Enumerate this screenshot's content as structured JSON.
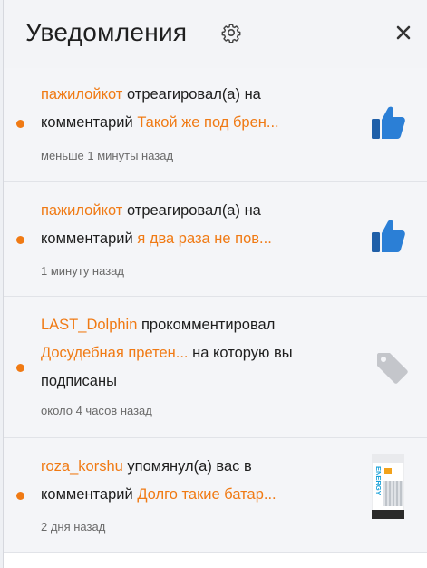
{
  "header": {
    "title": "Уведомления"
  },
  "notifications": [
    {
      "user": "пажилойкот",
      "action": " отреагировал(а) на ",
      "line2_prefix": "комментарий ",
      "target": "Такой же под брен...",
      "time": "меньше 1 минуты назад",
      "icon": "thumbs-up-icon"
    },
    {
      "user": "пажилойкот",
      "action": " отреагировал(а) на ",
      "line2_prefix": "комментарий ",
      "target": "я два раза не пов...",
      "time": "1 минуту назад",
      "icon": "thumbs-up-icon"
    },
    {
      "user": "LAST_Dolphin",
      "action": " прокомментировал",
      "target": "Досудебная претен...",
      "suffix": " на которую вы",
      "line3": "подписаны",
      "time": "около 4 часов назад",
      "icon": "tag-icon"
    },
    {
      "user": "roza_korshu",
      "action": " упомянул(а) вас в",
      "line2_prefix": "комментарий ",
      "target": "Долго такие батар...",
      "time": "2 дня назад",
      "icon": "product-thumbnail",
      "thumbnail_text": "ENERGY"
    }
  ],
  "colors": {
    "accent": "#f07a14",
    "like_blue": "#2b7fd6",
    "tag_gray": "#c4c6cb"
  }
}
